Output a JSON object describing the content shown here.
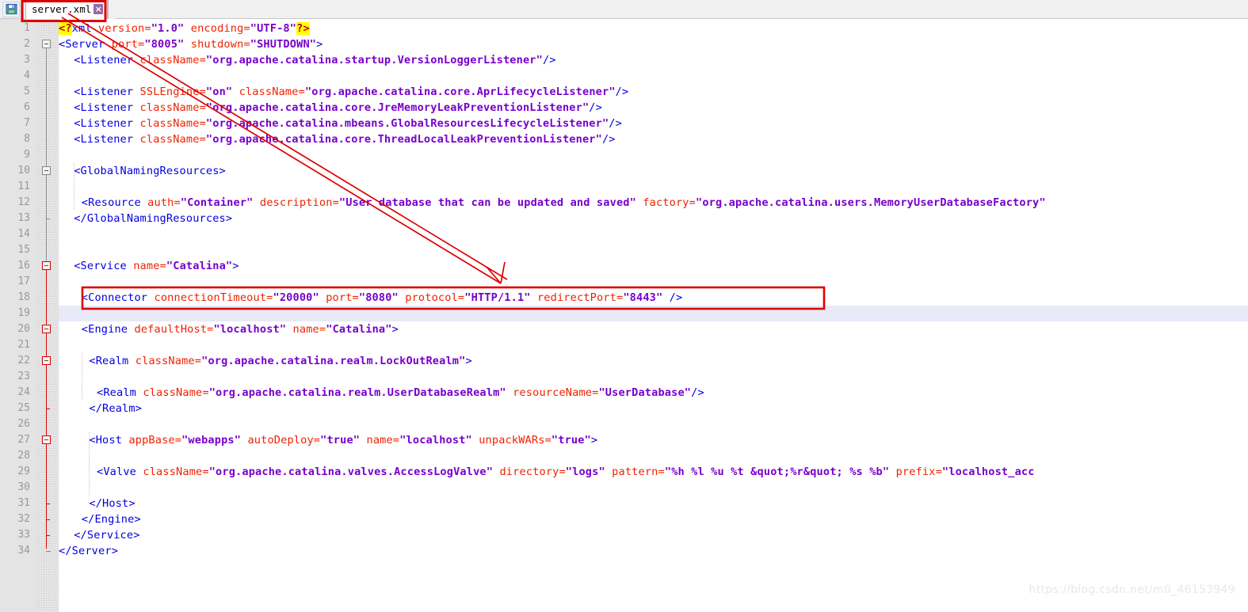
{
  "toolbar": {
    "save_icon": "save-floppy-icon",
    "tab": {
      "label": "server.xml",
      "close_label": "×"
    }
  },
  "editor": {
    "filename": "server.xml",
    "current_line": 19,
    "total_lines": 34,
    "colors": {
      "tag": "#0000dd",
      "attribute_name": "#ee2200",
      "attribute_value": "#7700cc",
      "highlight_yellow": "#ffff00",
      "current_line_bg": "#e8eaf8",
      "annotation_red": "#dd0000",
      "gutter_bg": "#e4e4e4",
      "lineno_fg": "#999999"
    },
    "lines": [
      {
        "n": 1,
        "indent": 0,
        "text": "<?xml version=\"1.0\" encoding=\"UTF-8\"?>"
      },
      {
        "n": 2,
        "indent": 0,
        "text": "<Server port=\"8005\" shutdown=\"SHUTDOWN\">"
      },
      {
        "n": 3,
        "indent": 2,
        "text": "<Listener className=\"org.apache.catalina.startup.VersionLoggerListener\"/>"
      },
      {
        "n": 4,
        "indent": 0,
        "text": ""
      },
      {
        "n": 5,
        "indent": 2,
        "text": "<Listener SSLEngine=\"on\" className=\"org.apache.catalina.core.AprLifecycleListener\"/>"
      },
      {
        "n": 6,
        "indent": 2,
        "text": "<Listener className=\"org.apache.catalina.core.JreMemoryLeakPreventionListener\"/>"
      },
      {
        "n": 7,
        "indent": 2,
        "text": "<Listener className=\"org.apache.catalina.mbeans.GlobalResourcesLifecycleListener\"/>"
      },
      {
        "n": 8,
        "indent": 2,
        "text": "<Listener className=\"org.apache.catalina.core.ThreadLocalLeakPreventionListener\"/>"
      },
      {
        "n": 9,
        "indent": 0,
        "text": ""
      },
      {
        "n": 10,
        "indent": 2,
        "text": "<GlobalNamingResources>"
      },
      {
        "n": 11,
        "indent": 0,
        "text": ""
      },
      {
        "n": 12,
        "indent": 3,
        "text": "<Resource auth=\"Container\" description=\"User database that can be updated and saved\" factory=\"org.apache.catalina.users.MemoryUserDatabaseFactory\""
      },
      {
        "n": 13,
        "indent": 2,
        "text": "</GlobalNamingResources>"
      },
      {
        "n": 14,
        "indent": 0,
        "text": ""
      },
      {
        "n": 15,
        "indent": 0,
        "text": ""
      },
      {
        "n": 16,
        "indent": 2,
        "text": "<Service name=\"Catalina\">"
      },
      {
        "n": 17,
        "indent": 0,
        "text": ""
      },
      {
        "n": 18,
        "indent": 3,
        "text": "<Connector connectionTimeout=\"20000\" port=\"8080\" protocol=\"HTTP/1.1\" redirectPort=\"8443\" />"
      },
      {
        "n": 19,
        "indent": 0,
        "text": ""
      },
      {
        "n": 20,
        "indent": 3,
        "text": "<Engine defaultHost=\"localhost\" name=\"Catalina\">"
      },
      {
        "n": 21,
        "indent": 0,
        "text": ""
      },
      {
        "n": 22,
        "indent": 4,
        "text": "<Realm className=\"org.apache.catalina.realm.LockOutRealm\">"
      },
      {
        "n": 23,
        "indent": 0,
        "text": ""
      },
      {
        "n": 24,
        "indent": 5,
        "text": "<Realm className=\"org.apache.catalina.realm.UserDatabaseRealm\" resourceName=\"UserDatabase\"/>"
      },
      {
        "n": 25,
        "indent": 4,
        "text": "</Realm>"
      },
      {
        "n": 26,
        "indent": 0,
        "text": ""
      },
      {
        "n": 27,
        "indent": 4,
        "text": "<Host appBase=\"webapps\" autoDeploy=\"true\" name=\"localhost\" unpackWARs=\"true\">"
      },
      {
        "n": 28,
        "indent": 0,
        "text": ""
      },
      {
        "n": 29,
        "indent": 5,
        "text": "<Valve className=\"org.apache.catalina.valves.AccessLogValve\" directory=\"logs\" pattern=\"%h %l %u %t &quot;%r&quot; %s %b\" prefix=\"localhost_acc"
      },
      {
        "n": 30,
        "indent": 0,
        "text": ""
      },
      {
        "n": 31,
        "indent": 4,
        "text": "</Host>"
      },
      {
        "n": 32,
        "indent": 3,
        "text": "</Engine>"
      },
      {
        "n": 33,
        "indent": 2,
        "text": "</Service>"
      },
      {
        "n": 34,
        "indent": 0,
        "text": "</Server>"
      }
    ]
  },
  "annotations": {
    "tab_box": "red-rectangle-around-tab",
    "arrow": "red-arrow-pointing-to-connector-protocol",
    "connector_box": "red-rectangle-around-connector-line"
  },
  "watermark": {
    "text": "https://blog.csdn.net/m0_46153949"
  }
}
